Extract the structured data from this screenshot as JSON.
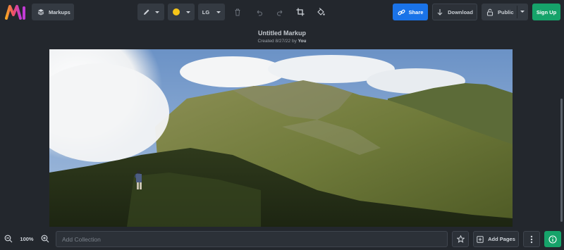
{
  "toolbar": {
    "markups_label": "Markups",
    "size_label": "LG",
    "share_label": "Share",
    "download_label": "Download",
    "visibility_label": "Public",
    "signup_label": "Sign Up",
    "active_color": "#f5c518"
  },
  "document": {
    "title": "Untitled Markup",
    "created_prefix": "Created 8/27/22 by",
    "author": "You"
  },
  "footer": {
    "zoom_level": "100%",
    "collection_placeholder": "Add Collection",
    "add_pages_label": "Add Pages"
  },
  "colors": {
    "accent_blue": "#1a73e8",
    "accent_green": "#16a36a",
    "background": "#23272d"
  }
}
